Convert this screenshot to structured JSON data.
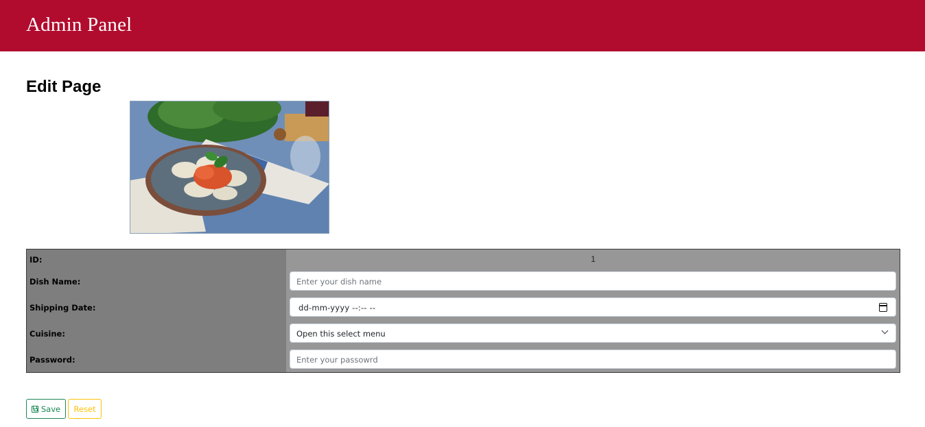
{
  "header": {
    "brand": "Admin Panel"
  },
  "page": {
    "title": "Edit Page"
  },
  "dish_image": {
    "alt": "Ravioli with tomato sauce"
  },
  "form": {
    "id": {
      "label": "ID:",
      "value": "1"
    },
    "dish_name": {
      "label": "Dish Name:",
      "placeholder": "Enter your dish name",
      "value": ""
    },
    "shipping_date": {
      "label": "Shipping Date:",
      "value": "dd-mm-yyyy --:--  --"
    },
    "cuisine": {
      "label": "Cuisine:",
      "selected": "Open this select menu"
    },
    "password": {
      "label": "Password:",
      "placeholder": "Enter your passowrd",
      "value": ""
    }
  },
  "buttons": {
    "save": "Save",
    "reset": "Reset"
  },
  "colors": {
    "header_bg": "#b10c2e",
    "save": "#198754",
    "reset": "#ffc107"
  },
  "icons": {
    "save": "floppy-disk-icon",
    "calendar": "calendar-icon",
    "dropdown": "chevron-down-icon"
  }
}
